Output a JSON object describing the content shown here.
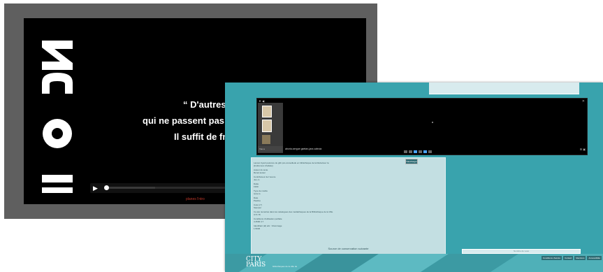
{
  "player": {
    "logo_text": "INOUI",
    "quote_line1": "“ D'autres v",
    "quote_line2": "qui ne passent pas er",
    "quote_line3": "Il suffit de frapp",
    "author_fragment": "Ma",
    "red_caption": "planes l'ntro",
    "play_glyph": "▶",
    "progress": 0.4
  },
  "viewer": {
    "toolbar_left": "▼ ◀",
    "close_glyph": "✕",
    "thumb_select": "Vue a",
    "caption": "aboria-sergue gaetan-jara-valecia",
    "right_glyph": "⊞ ▣"
  },
  "panel": {
    "action_button": "Télécharger",
    "lines": [
      "Lancez Ayazi pelocure de gbb pré-conseilledu en bibliothèque de la Réducteur la",
      "[Institut aux chabaie]",
      "Auteur du texte",
      "Rénel auteur",
      "Contributeur de l'œuvre",
      "Jeu-m",
      "Datte",
      "1930",
      "Type de média",
      "texte ts",
      "Date",
      "Pauline",
      "Cote (n°)",
      "Sauveur",
      "Il a été numérisé dans les catalogues des médiathèques de la Bibliothèque de la Ville",
      "IV 5 78",
      "Conditions d'utilisation parfaite",
      "4.4500 4.7",
      "Identifiant (id) ark : Visionnage",
      "1.5036"
    ],
    "footer_text": "Source de conservation suivante"
  },
  "right_box": "Nombre de vues",
  "footer": {
    "logo_line1": "CITY",
    "logo_line2": "PARIS",
    "logo_sub": "bibliothèques de la ville de",
    "buttons": [
      "Conditions d'accès",
      "Contact",
      "Mentions",
      "Accessibilité"
    ]
  },
  "colors": {
    "teal_bg": "#39a3ad",
    "panel_bg": "#c3dfe2",
    "dark_btn": "#2e6b73",
    "red_caption": "#c0392b"
  }
}
